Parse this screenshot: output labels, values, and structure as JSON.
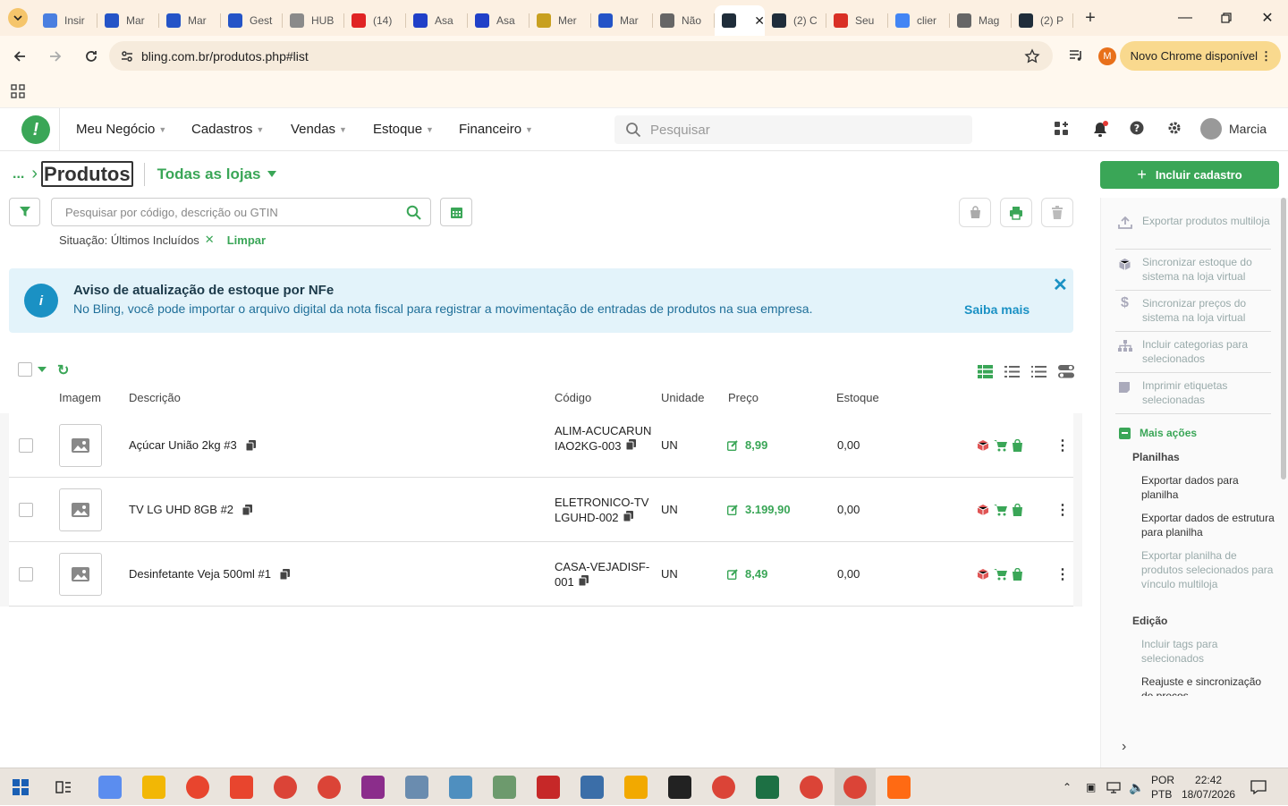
{
  "browser": {
    "tabs": [
      {
        "label": "Insir",
        "color": "#4a7fe0"
      },
      {
        "label": "Mar",
        "color": "#2454c7"
      },
      {
        "label": "Mar",
        "color": "#2454c7"
      },
      {
        "label": "Gest",
        "color": "#2454c7"
      },
      {
        "label": "HUB",
        "color": "#8a8a8a"
      },
      {
        "label": "(14)",
        "color": "#e02424"
      },
      {
        "label": "Asa",
        "color": "#2040c8"
      },
      {
        "label": "Asa",
        "color": "#2040c8"
      },
      {
        "label": "Mer",
        "color": "#c8a020"
      },
      {
        "label": "Mar",
        "color": "#2454c7"
      },
      {
        "label": "Não",
        "color": "#666666"
      },
      {
        "label": "",
        "color": "#1f2d3a",
        "active": true
      },
      {
        "label": "(2) C",
        "color": "#1f2d3a"
      },
      {
        "label": "Seu",
        "color": "#d93025"
      },
      {
        "label": "clier",
        "color": "#4285f4"
      },
      {
        "label": "Mag",
        "color": "#666666"
      },
      {
        "label": "(2) P",
        "color": "#1f2d3a"
      }
    ],
    "url": "bling.com.br/produtos.php#list",
    "profile_initial": "M",
    "update_label": "Novo Chrome disponível"
  },
  "header": {
    "menus": [
      "Meu Negócio",
      "Cadastros",
      "Vendas",
      "Estoque",
      "Financeiro"
    ],
    "search_placeholder": "Pesquisar",
    "user_name": "Marcia"
  },
  "page": {
    "breadcrumb_ellipsis": "...",
    "title": "Produtos",
    "store_selector": "Todas as lojas",
    "include_button": "Incluir cadastro",
    "search_placeholder": "Pesquisar por código, descrição ou GTIN",
    "filter_label": "Situação: Últimos Incluídos",
    "clear_label": "Limpar"
  },
  "alert": {
    "title": "Aviso de atualização de estoque por NFe",
    "body": "No Bling, você pode importar o arquivo digital da nota fiscal para registrar a movimentação de entradas de produtos na sua empresa.",
    "link": "Saiba mais"
  },
  "table": {
    "headers": {
      "image": "Imagem",
      "description": "Descrição",
      "code": "Código",
      "unit": "Unidade",
      "price": "Preço",
      "stock": "Estoque"
    },
    "rows": [
      {
        "description": "Açúcar União 2kg #3",
        "code": "ALIM-ACUCARUNIAO2KG-003",
        "unit": "UN",
        "price": "8,99",
        "stock": "0,00"
      },
      {
        "description": "TV LG UHD 8GB #2",
        "code": "ELETRONICO-TVLGUHD-002",
        "unit": "UN",
        "price": "3.199,90",
        "stock": "0,00"
      },
      {
        "description": "Desinfetante Veja 500ml #1",
        "code": "CASA-VEJADISF-001",
        "unit": "UN",
        "price": "8,49",
        "stock": "0,00"
      }
    ]
  },
  "side_panel": {
    "actions": [
      "Exportar produtos multiloja",
      "Sincronizar estoque do sistema na loja virtual",
      "Sincronizar preços do sistema na loja virtual",
      "Incluir categorias para selecionados",
      "Imprimir etiquetas selecionadas"
    ],
    "more_actions": "Mais ações",
    "sheets_heading": "Planilhas",
    "sheets_items": [
      "Exportar dados para planilha",
      "Exportar dados de estrutura para planilha",
      "Exportar planilha de produtos selecionados para vínculo multiloja"
    ],
    "edit_heading": "Edição",
    "edit_items": [
      "Incluir tags para selecionados",
      "Reajuste e sincronização de preços"
    ]
  },
  "taskbar": {
    "lang_top": "POR",
    "lang_bottom": "PTB",
    "time": "22:42",
    "date": "18/07/2026"
  }
}
